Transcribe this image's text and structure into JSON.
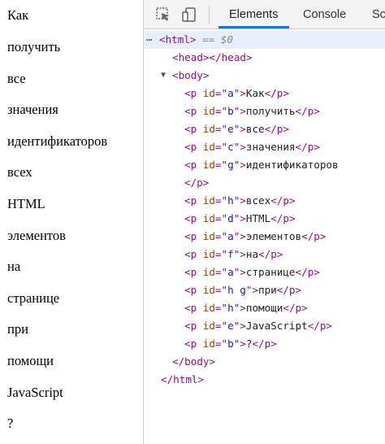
{
  "page_lines": [
    "Как",
    "получить",
    "все",
    "значения",
    "идентификаторов",
    "всех",
    "HTML",
    "элементов",
    "на",
    "странице",
    "при",
    "помощи",
    "JavaScript",
    "?"
  ],
  "devtools": {
    "tabs": [
      "Elements",
      "Console",
      "Sc"
    ],
    "icons": [
      "inspect-element-icon",
      "device-toolbar-icon"
    ],
    "html_open": "<html>",
    "eq_label": "== $0",
    "head_line": "<head></head>",
    "body_open": "<body>",
    "p_rows": [
      {
        "id": "a",
        "text": "Как"
      },
      {
        "id": "b",
        "text": "получить"
      },
      {
        "id": "e",
        "text": "все"
      },
      {
        "id": "c",
        "text": "значения"
      },
      {
        "id": "g",
        "text": "идентификаторов"
      },
      {
        "id": "h",
        "text": "всех"
      },
      {
        "id": "d",
        "text": "HTML"
      },
      {
        "id": "a",
        "text": "элементов"
      },
      {
        "id": "f",
        "text": "на"
      },
      {
        "id": "a",
        "text": "странице"
      },
      {
        "id": "h g",
        "text": "при"
      },
      {
        "id": "h",
        "text": "помощи"
      },
      {
        "id": "e",
        "text": "JavaScript"
      },
      {
        "id": "b",
        "text": "?"
      }
    ],
    "close_p": "</p>",
    "body_close": "</body>",
    "html_close": "</html>"
  }
}
